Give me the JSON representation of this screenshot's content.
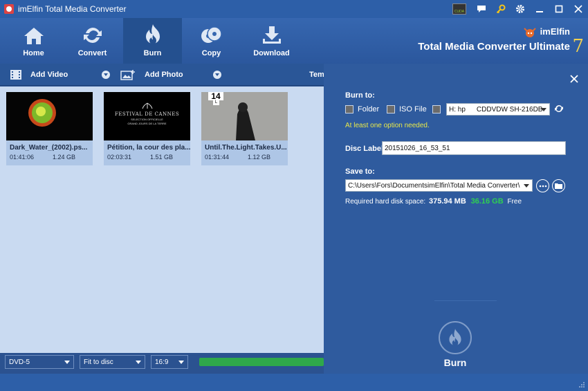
{
  "window": {
    "title": "imElfin Total Media Converter",
    "cuda_label": "CUDA"
  },
  "nav": [
    {
      "label": "Home",
      "icon": "home-icon"
    },
    {
      "label": "Convert",
      "icon": "convert-icon"
    },
    {
      "label": "Burn",
      "icon": "burn-icon"
    },
    {
      "label": "Copy",
      "icon": "copy-icon"
    },
    {
      "label": "Download",
      "icon": "download-icon"
    }
  ],
  "brand": {
    "logo": "imElfin",
    "product": "Total Media Converter Ultimate",
    "version": "7"
  },
  "subbar": {
    "add_video": "Add Video",
    "add_photo": "Add Photo",
    "template": "Tem"
  },
  "videos": [
    {
      "name": "Dark_Water_(2002).ps...",
      "duration": "01:41:06",
      "size": "1.24 GB"
    },
    {
      "name": "Pétition, la cour des pla...",
      "duration": "02:03:31",
      "size": "1.51 GB"
    },
    {
      "name": "Until.The.Light.Takes.U...",
      "duration": "01:31:44",
      "size": "1.12 GB"
    }
  ],
  "thumb2_text": {
    "line1": "FESTIVAL DE CANNES",
    "line2": "SELECTION OFFICIELLE",
    "line3": "GRAND JOURS DE LA TERRE"
  },
  "thumb3_badge": "14",
  "thumb3_badge_small": "L",
  "bottom": {
    "disc_type": "DVD-5",
    "fit": "Fit to disc",
    "aspect": "16:9",
    "progress": 1.0
  },
  "burn": {
    "burn_to_label": "Burn to:",
    "folder_label": "Folder",
    "iso_label": "ISO File",
    "drive_letter": "H: hp",
    "drive_model": "CDDVDW SH-216DB",
    "warning": "At least one option needed.",
    "disc_label_label": "Disc Label:",
    "disc_label_value": "20151026_16_53_51",
    "save_to_label": "Save to:",
    "save_path": "C:\\Users\\Fors\\DocumentsimElfin\\Total Media Converter\\",
    "space_label": "Required hard disk space:",
    "space_required": "375.94 MB",
    "space_free": "36.16 GB",
    "free_label": "Free",
    "burn_button": "Burn"
  },
  "colors": {
    "warning": "#e8e84a",
    "free_space": "#2fcf52",
    "progress": "#2fa84a"
  }
}
